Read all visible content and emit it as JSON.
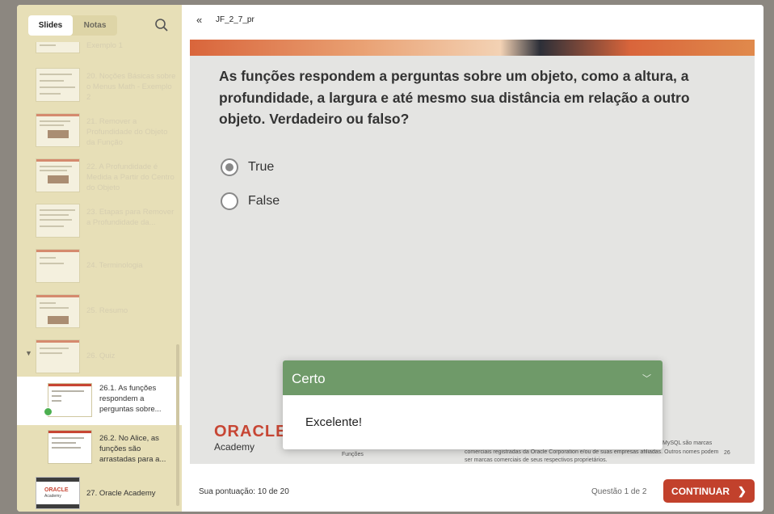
{
  "sidebar": {
    "tabs": [
      {
        "label": "Slides"
      },
      {
        "label": "Notas"
      }
    ],
    "items": [
      {
        "label": "Exemplo 1"
      },
      {
        "label": "20. Noções Básicas sobre o Menus Math - Exemplo 2"
      },
      {
        "label": "21. Remover a Profundidade do Objeto da Função"
      },
      {
        "label": "22. A Profundidade é Medida a Partir do Centro do Objeto"
      },
      {
        "label": "23. Etapas para Remover a Profundidade da..."
      },
      {
        "label": "24. Terminologia"
      },
      {
        "label": "25. Resumo"
      },
      {
        "label": "26. Quiz"
      }
    ],
    "sub_items": [
      {
        "label": "26.1.  As funções respondem a perguntas sobre..."
      },
      {
        "label": "26.2.  No Alice, as funções são arrastadas para a..."
      }
    ],
    "last_item": {
      "label": "27. Oracle Academy",
      "thumb_word": "ORACLE",
      "thumb_sub": "Academy"
    }
  },
  "header": {
    "title": "JF_2_7_pr"
  },
  "slide": {
    "question": " As funções respondem a perguntas sobre um objeto, como a altura, a profundidade, a largura e até mesmo sua distância em relação a outro objeto. Verdadeiro ou falso?",
    "options": [
      {
        "label": "True",
        "selected": true
      },
      {
        "label": "False",
        "selected": false
      }
    ],
    "logo": "ORACLE",
    "logo_sub": "Academy",
    "footer_left": "Funções",
    "footer_copyright": "comerciais registradas da Oracle Corporation e/ou de suas empresas afiliadas. Outros nomes podem ser marcas comerciais de seus respectivos proprietários.",
    "footer_copyright_top": "MySQL são marcas",
    "page_number": "26"
  },
  "feedback": {
    "title": "Certo",
    "message": "Excelente!",
    "header_color": "#6f9a69"
  },
  "bottom": {
    "score": "Sua pontuação: 10 de 20",
    "question_count": "Questão 1 de 2",
    "continue_label": "CONTINUAR"
  }
}
